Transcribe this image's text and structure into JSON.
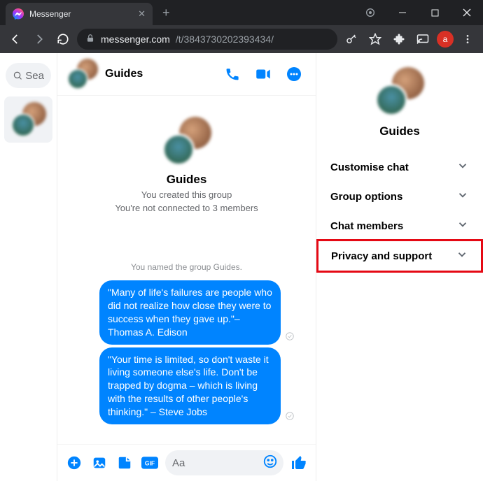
{
  "browser": {
    "tab_title": "Messenger",
    "url_host": "messenger.com",
    "url_path": "/t/3843730202393434/",
    "avatar_letter": "a"
  },
  "sidebar": {
    "search_placeholder": "Sea"
  },
  "chat": {
    "header_name": "Guides",
    "hero_name": "Guides",
    "hero_sub1": "You created this group",
    "hero_sub2": "You're not connected to 3 members",
    "system_message": "You named the group Guides.",
    "messages": [
      {
        "text": "\"Many of life's failures are people who did not realize how close they were to success when they gave up.\"– Thomas A. Edison"
      },
      {
        "text": "\"Your time is limited, so don't waste it living someone else's life. Don't be trapped by dogma – which is living with the results of other people's thinking.\" – Steve Jobs"
      }
    ],
    "composer_placeholder": "Aa"
  },
  "info": {
    "title": "Guides",
    "sections": [
      {
        "label": "Customise chat",
        "highlight": false
      },
      {
        "label": "Group options",
        "highlight": false
      },
      {
        "label": "Chat members",
        "highlight": false
      },
      {
        "label": "Privacy and support",
        "highlight": true
      }
    ]
  }
}
